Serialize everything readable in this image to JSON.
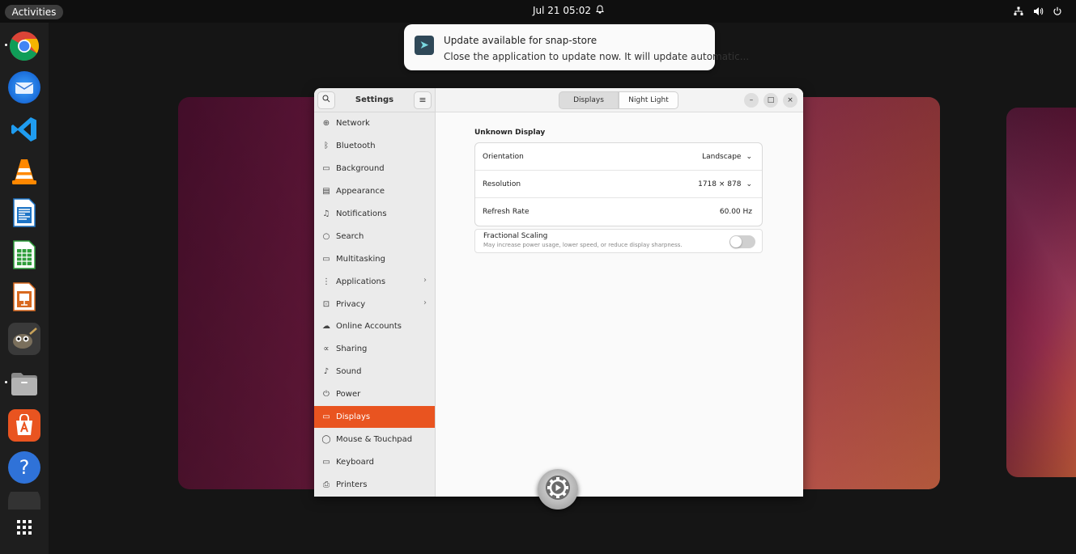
{
  "topbar": {
    "activities": "Activities",
    "clock": "Jul 21  05:02",
    "tray_icons": [
      "network-icon",
      "volume-icon",
      "power-icon"
    ]
  },
  "dock": {
    "apps": [
      {
        "name": "Google Chrome",
        "icon": "chrome-icon"
      },
      {
        "name": "Thunderbird",
        "icon": "thunderbird-icon"
      },
      {
        "name": "Visual Studio Code",
        "icon": "vscode-icon"
      },
      {
        "name": "VLC",
        "icon": "vlc-icon"
      },
      {
        "name": "LibreOffice Writer",
        "icon": "writer-icon"
      },
      {
        "name": "LibreOffice Calc",
        "icon": "calc-icon"
      },
      {
        "name": "LibreOffice Impress",
        "icon": "impress-icon"
      },
      {
        "name": "GIMP",
        "icon": "gimp-icon"
      },
      {
        "name": "Files",
        "icon": "files-icon"
      },
      {
        "name": "Ubuntu Software",
        "icon": "software-icon"
      },
      {
        "name": "Help",
        "icon": "help-icon"
      },
      {
        "name": "Show Applications",
        "icon": "app-grid-icon"
      }
    ]
  },
  "notification": {
    "title": "Update available for snap-store",
    "body": "Close the application to update now. It will update automatic..."
  },
  "settings": {
    "title": "Settings",
    "nav": [
      {
        "label": "Network",
        "icon": "network-icon"
      },
      {
        "label": "Bluetooth",
        "icon": "bluetooth-icon"
      },
      {
        "label": "Background",
        "icon": "background-icon"
      },
      {
        "label": "Appearance",
        "icon": "appearance-icon"
      },
      {
        "label": "Notifications",
        "icon": "bell-icon"
      },
      {
        "label": "Search",
        "icon": "search-icon"
      },
      {
        "label": "Multitasking",
        "icon": "multitasking-icon"
      },
      {
        "label": "Applications",
        "icon": "apps-icon"
      },
      {
        "label": "Privacy",
        "icon": "lock-icon"
      },
      {
        "label": "Online Accounts",
        "icon": "cloud-icon"
      },
      {
        "label": "Sharing",
        "icon": "share-icon"
      },
      {
        "label": "Sound",
        "icon": "music-icon"
      },
      {
        "label": "Power",
        "icon": "power-icon"
      },
      {
        "label": "Displays",
        "icon": "display-icon"
      },
      {
        "label": "Mouse & Touchpad",
        "icon": "mouse-icon"
      },
      {
        "label": "Keyboard",
        "icon": "keyboard-icon"
      },
      {
        "label": "Printers",
        "icon": "printer-icon"
      }
    ],
    "active_nav": "Displays",
    "tabs": {
      "displays": "Displays",
      "night_light": "Night Light"
    },
    "display_name": "Unknown Display",
    "orientation": {
      "label": "Orientation",
      "value": "Landscape"
    },
    "resolution": {
      "label": "Resolution",
      "value": "1718 × 878"
    },
    "refresh": {
      "label": "Refresh Rate",
      "value": "60.00 Hz"
    },
    "fractional": {
      "label": "Fractional Scaling",
      "sub_1": "May increase power usage,",
      "sub_2": "lower",
      "sub_3": "speed,",
      "sub_4": "or",
      "sub_5": "reduce display sharpness.",
      "enabled": false
    }
  },
  "colors": {
    "accent": "#e95420"
  }
}
